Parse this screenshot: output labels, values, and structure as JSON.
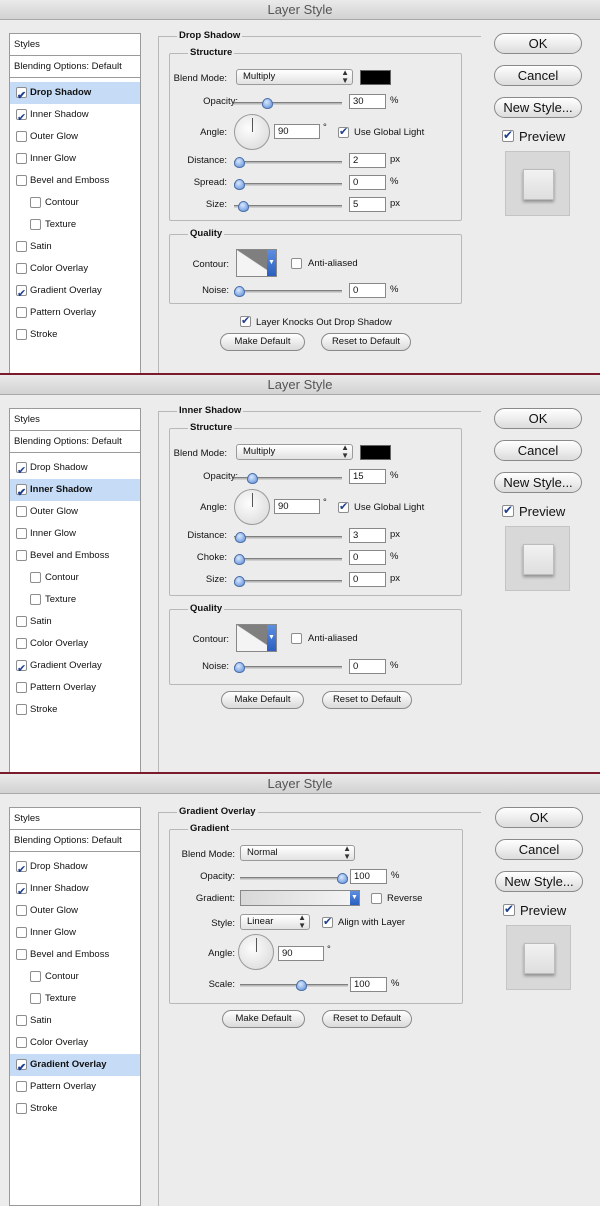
{
  "dialogs": [
    {
      "title": "Layer Style",
      "sidebar": {
        "header": "Styles",
        "blending": "Blending Options: Default",
        "items": [
          {
            "label": "Drop Shadow",
            "checked": true,
            "selected": true
          },
          {
            "label": "Inner Shadow",
            "checked": true,
            "selected": false
          },
          {
            "label": "Outer Glow",
            "checked": false,
            "selected": false
          },
          {
            "label": "Inner Glow",
            "checked": false,
            "selected": false
          },
          {
            "label": "Bevel and Emboss",
            "checked": false,
            "selected": false
          },
          {
            "label": "Contour",
            "checked": false,
            "selected": false
          },
          {
            "label": "Texture",
            "checked": false,
            "selected": false
          },
          {
            "label": "Satin",
            "checked": false,
            "selected": false
          },
          {
            "label": "Color Overlay",
            "checked": false,
            "selected": false
          },
          {
            "label": "Gradient Overlay",
            "checked": true,
            "selected": false
          },
          {
            "label": "Pattern Overlay",
            "checked": false,
            "selected": false
          },
          {
            "label": "Stroke",
            "checked": false,
            "selected": false
          }
        ]
      },
      "panel_title": "Drop Shadow",
      "structure": {
        "title": "Structure",
        "blend_mode_label": "Blend Mode:",
        "blend_mode": "Multiply",
        "swatch_color": "#000000",
        "opacity_label": "Opacity:",
        "opacity": "30",
        "angle_label": "Angle:",
        "angle": "90",
        "use_global_light": "Use Global Light",
        "distance_label": "Distance:",
        "distance": "2",
        "spread_label": "Spread:",
        "spread": "0",
        "size_label": "Size:",
        "size": "5"
      },
      "quality": {
        "title": "Quality",
        "contour_label": "Contour:",
        "anti_aliased": "Anti-aliased",
        "noise_label": "Noise:",
        "noise": "0"
      },
      "knocks_out": "Layer Knocks Out Drop Shadow",
      "make_default": "Make Default",
      "reset_default": "Reset to Default",
      "buttons": {
        "ok": "OK",
        "cancel": "Cancel",
        "new_style": "New Style...",
        "preview": "Preview"
      }
    },
    {
      "title": "Layer Style",
      "sidebar": {
        "header": "Styles",
        "blending": "Blending Options: Default",
        "items": [
          {
            "label": "Drop Shadow",
            "checked": true,
            "selected": false
          },
          {
            "label": "Inner Shadow",
            "checked": true,
            "selected": true
          },
          {
            "label": "Outer Glow",
            "checked": false,
            "selected": false
          },
          {
            "label": "Inner Glow",
            "checked": false,
            "selected": false
          },
          {
            "label": "Bevel and Emboss",
            "checked": false,
            "selected": false
          },
          {
            "label": "Contour",
            "checked": false,
            "selected": false
          },
          {
            "label": "Texture",
            "checked": false,
            "selected": false
          },
          {
            "label": "Satin",
            "checked": false,
            "selected": false
          },
          {
            "label": "Color Overlay",
            "checked": false,
            "selected": false
          },
          {
            "label": "Gradient Overlay",
            "checked": true,
            "selected": false
          },
          {
            "label": "Pattern Overlay",
            "checked": false,
            "selected": false
          },
          {
            "label": "Stroke",
            "checked": false,
            "selected": false
          }
        ]
      },
      "panel_title": "Inner Shadow",
      "structure": {
        "title": "Structure",
        "blend_mode_label": "Blend Mode:",
        "blend_mode": "Multiply",
        "swatch_color": "#000000",
        "opacity_label": "Opacity:",
        "opacity": "15",
        "angle_label": "Angle:",
        "angle": "90",
        "use_global_light": "Use Global Light",
        "distance_label": "Distance:",
        "distance": "3",
        "choke_label": "Choke:",
        "choke": "0",
        "size_label": "Size:",
        "size": "0"
      },
      "quality": {
        "title": "Quality",
        "contour_label": "Contour:",
        "anti_aliased": "Anti-aliased",
        "noise_label": "Noise:",
        "noise": "0"
      },
      "make_default": "Make Default",
      "reset_default": "Reset to Default",
      "buttons": {
        "ok": "OK",
        "cancel": "Cancel",
        "new_style": "New Style...",
        "preview": "Preview"
      }
    },
    {
      "title": "Layer Style",
      "sidebar": {
        "header": "Styles",
        "blending": "Blending Options: Default",
        "items": [
          {
            "label": "Drop Shadow",
            "checked": true,
            "selected": false
          },
          {
            "label": "Inner Shadow",
            "checked": true,
            "selected": false
          },
          {
            "label": "Outer Glow",
            "checked": false,
            "selected": false
          },
          {
            "label": "Inner Glow",
            "checked": false,
            "selected": false
          },
          {
            "label": "Bevel and Emboss",
            "checked": false,
            "selected": false
          },
          {
            "label": "Contour",
            "checked": false,
            "selected": false
          },
          {
            "label": "Texture",
            "checked": false,
            "selected": false
          },
          {
            "label": "Satin",
            "checked": false,
            "selected": false
          },
          {
            "label": "Color Overlay",
            "checked": false,
            "selected": false
          },
          {
            "label": "Gradient Overlay",
            "checked": true,
            "selected": true
          },
          {
            "label": "Pattern Overlay",
            "checked": false,
            "selected": false
          },
          {
            "label": "Stroke",
            "checked": false,
            "selected": false
          }
        ]
      },
      "panel_title": "Gradient Overlay",
      "gradient": {
        "title": "Gradient",
        "blend_mode_label": "Blend Mode:",
        "blend_mode": "Normal",
        "opacity_label": "Opacity:",
        "opacity": "100",
        "gradient_label": "Gradient:",
        "reverse": "Reverse",
        "style_label": "Style:",
        "style": "Linear",
        "align_with_layer": "Align with Layer",
        "angle_label": "Angle:",
        "angle": "90",
        "scale_label": "Scale:",
        "scale": "100"
      },
      "make_default": "Make Default",
      "reset_default": "Reset to Default",
      "buttons": {
        "ok": "OK",
        "cancel": "Cancel",
        "new_style": "New Style...",
        "preview": "Preview"
      }
    }
  ],
  "units": {
    "percent": "%",
    "px": "px",
    "degree": "°"
  }
}
